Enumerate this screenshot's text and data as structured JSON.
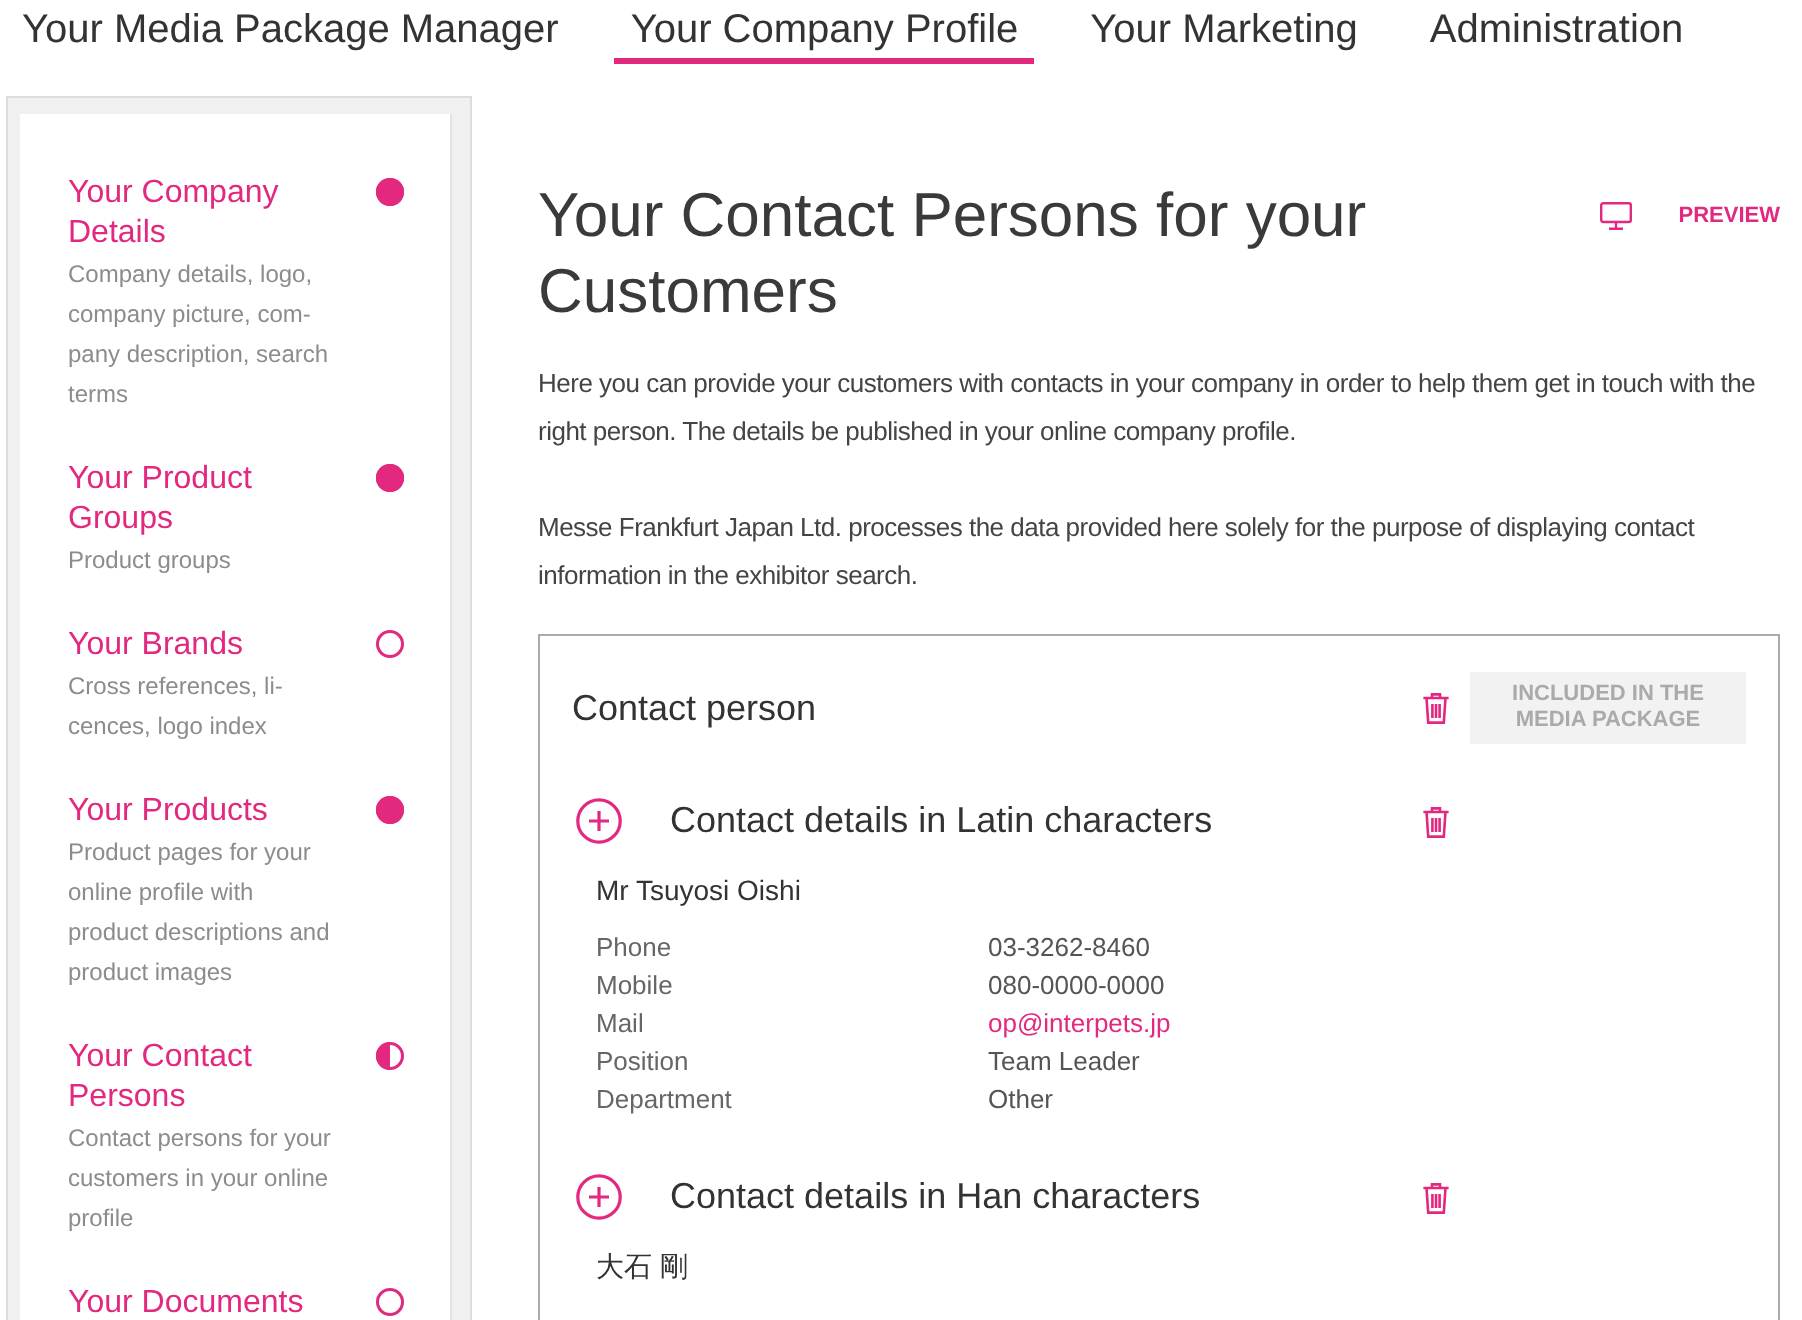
{
  "nav": {
    "tabs": [
      {
        "label": "Your Media Package Manager",
        "selected": false
      },
      {
        "label": "Your Company Profile",
        "selected": true
      },
      {
        "label": "Your Marketing",
        "selected": false
      },
      {
        "label": "Administration",
        "selected": false
      }
    ]
  },
  "sidebar": {
    "items": [
      {
        "title": "Your Company Details",
        "description": "Company details, logo, company picture, com-pany description, search terms",
        "started": true,
        "finished": true
      },
      {
        "title": "Your Product Groups",
        "description": "Product groups",
        "started": true,
        "finished": true
      },
      {
        "title": "Your Brands",
        "description": "Cross references, li-cences, logo index",
        "started": false,
        "finished": false
      },
      {
        "title": "Your Products",
        "description": "Product pages for your online profile with product descriptions and product images",
        "started": true,
        "finished": true
      },
      {
        "title": "Your Contact Persons",
        "description": "Contact persons for your customers in your online profile",
        "started": true,
        "finished": false
      },
      {
        "title": "Your Documents",
        "started": false,
        "finished": false
      }
    ]
  },
  "main": {
    "title": "Your Contact Persons for your Customers",
    "preview": {
      "label": "PREVIEW"
    },
    "paragraphs": [
      "Here you can provide your customers with contacts in your company in order to help them get in touch with the right person. The details be published in your online company profile.",
      "Messe Frankfurt Japan Ltd. processes the data provided here solely for the purpose of displaying contact information in the exhibitor search."
    ],
    "card": {
      "title": "Contact person",
      "badge": {
        "label": "INCLUDED IN THE MEDIA PACKAGE",
        "disabled": true
      },
      "sections": [
        {
          "title": "Contact details in Latin characters",
          "name": "Mr Tsuyosi Oishi",
          "rows": [
            {
              "label": "Phone",
              "value": "03-3262-8460",
              "kind": "text"
            },
            {
              "label": "Mobile",
              "value": "080-0000-0000",
              "kind": "text"
            },
            {
              "label": "Mail",
              "value": "op@interpets.jp",
              "kind": "email"
            },
            {
              "label": "Position",
              "value": "Team Leader",
              "kind": "text"
            },
            {
              "label": "Department",
              "value": "Other",
              "kind": "text"
            }
          ]
        },
        {
          "title": "Contact details in Han characters",
          "name": "大石 剛"
        }
      ]
    }
  }
}
